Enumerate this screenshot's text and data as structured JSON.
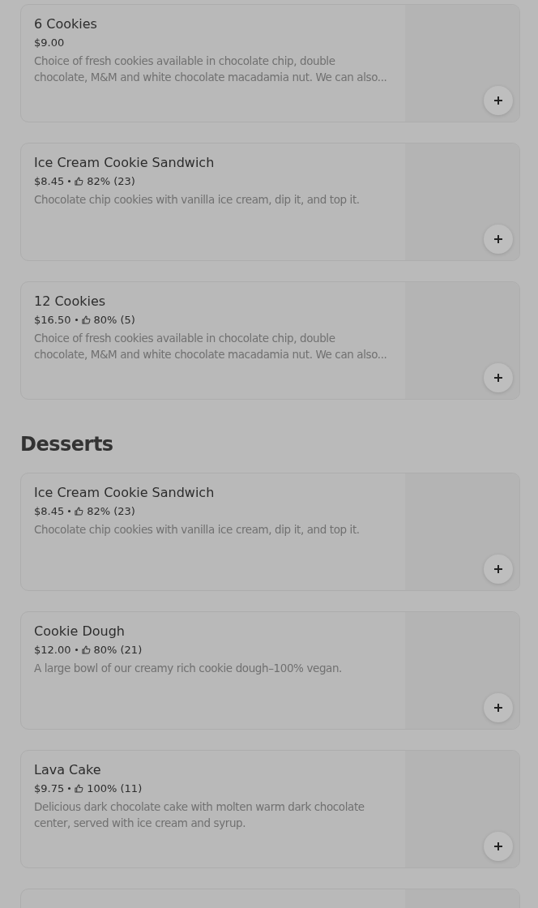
{
  "sections": [
    {
      "items": [
        {
          "name": "6 Cookies",
          "price": "$9.00",
          "description": "Choice of fresh cookies available in chocolate chip, double chocolate, M&M and white chocolate macadamia nut. We can also..."
        },
        {
          "name": "Ice Cream Cookie Sandwich",
          "price": "$8.45",
          "rating": "82% (23)",
          "description": "Chocolate chip cookies with vanilla ice cream, dip it, and top it."
        },
        {
          "name": "12 Cookies",
          "price": "$16.50",
          "rating": "80% (5)",
          "description": "Choice of fresh cookies available in chocolate chip, double chocolate, M&M and white chocolate macadamia nut. We can also..."
        }
      ]
    },
    {
      "title": "Desserts",
      "items": [
        {
          "name": "Ice Cream Cookie Sandwich",
          "price": "$8.45",
          "rating": "82% (23)",
          "description": "Chocolate chip cookies with vanilla ice cream, dip it, and top it."
        },
        {
          "name": "Cookie Dough",
          "price": "$12.00",
          "rating": "80% (21)",
          "description": "A large bowl of our creamy rich cookie dough–100% vegan."
        },
        {
          "name": "Lava Cake",
          "price": "$9.75",
          "rating": "100% (11)",
          "description": "Delicious dark chocolate cake with molten warm dark chocolate center, served with ice cream and syrup."
        }
      ],
      "more_cards_below": true
    }
  ]
}
